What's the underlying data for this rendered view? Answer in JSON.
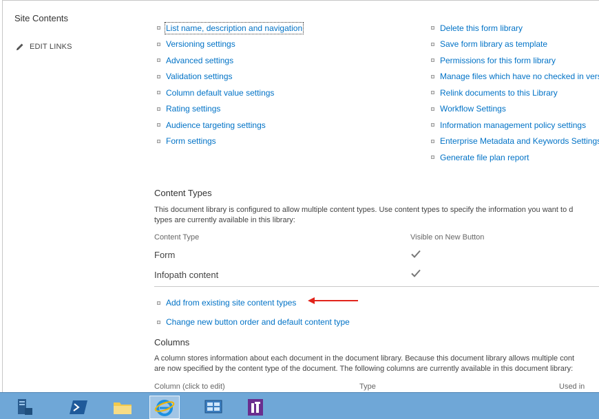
{
  "sidebar": {
    "title": "Site Contents",
    "edit_links": "EDIT LINKS",
    "edit_icon": "pencil-icon"
  },
  "settings_left": [
    "List name, description and navigation",
    "Versioning settings",
    "Advanced settings",
    "Validation settings",
    "Column default value settings",
    "Rating settings",
    "Audience targeting settings",
    "Form settings"
  ],
  "settings_right": [
    "Delete this form library",
    "Save form library as template",
    "Permissions for this form library",
    "Manage files which have no checked in versio",
    "Relink documents to this Library",
    "Workflow Settings",
    "Information management policy settings",
    "Enterprise Metadata and Keywords Settings",
    "Generate file plan report"
  ],
  "content_types": {
    "title": "Content Types",
    "description_line1": "This document library is configured to allow multiple content types. Use content types to specify the information you want to d",
    "description_line2": "types are currently available in this library:",
    "header_type": "Content Type",
    "header_visible": "Visible on New Button",
    "rows": [
      {
        "name": "Form",
        "visible": true
      },
      {
        "name": "Infopath content",
        "visible": true
      }
    ],
    "add_link": "Add from existing site content types",
    "order_link": "Change new button order and default content type",
    "annotation_color": "#e2231a"
  },
  "columns": {
    "title": "Columns",
    "description_line1": "A column stores information about each document in the document library. Because this document library allows multiple cont",
    "description_line2": "are now specified by the content type of the document. The following columns are currently available in this document library:",
    "header_column": "Column (click to edit)",
    "header_type": "Type",
    "header_used": "Used in"
  },
  "taskbar": {
    "color": "#6fa7d7",
    "items": [
      "server-manager-icon",
      "powershell-icon",
      "file-explorer-icon",
      "internet-explorer-icon",
      "control-panel-icon",
      "infopath-icon"
    ]
  }
}
